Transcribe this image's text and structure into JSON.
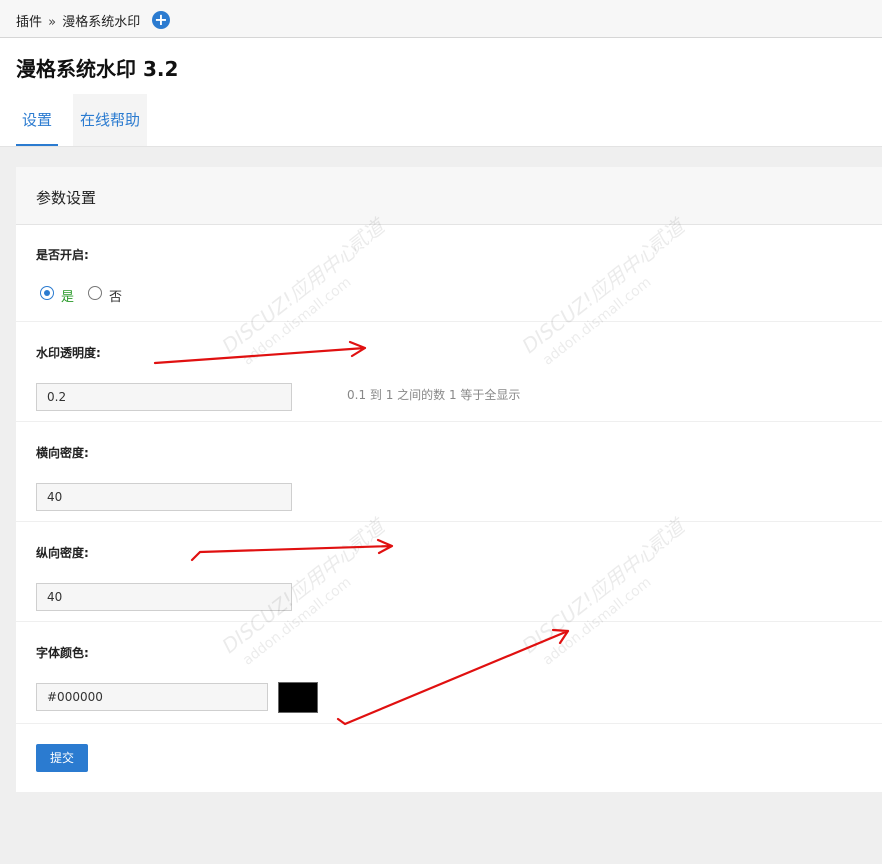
{
  "breadcrumb": {
    "root": "插件",
    "separator": "»",
    "current": "漫格系统水印"
  },
  "header": {
    "title": "漫格系统水印 3.2"
  },
  "tabs": [
    {
      "label": "设置"
    },
    {
      "label": "在线帮助"
    }
  ],
  "panel": {
    "title": "参数设置"
  },
  "form": {
    "enable": {
      "label": "是否开启:",
      "options": [
        "是",
        "否"
      ],
      "selected": "是"
    },
    "opacity": {
      "label": "水印透明度:",
      "value": "0.2",
      "hint": "0.1 到 1 之间的数 1 等于全显示"
    },
    "h_density": {
      "label": "横向密度:",
      "value": "40"
    },
    "v_density": {
      "label": "纵向密度:",
      "value": "40"
    },
    "font_color": {
      "label": "字体颜色:",
      "value": "#000000",
      "swatch": "#000000"
    },
    "submit_label": "提交"
  },
  "watermark": {
    "brand": "DISCUZ!应用中心",
    "site": "addon.dismall.com",
    "tag": "贰道"
  },
  "colors": {
    "accent": "#2b7bd0",
    "annotation": "#e01010",
    "radio_selected_text": "#2a9a2a"
  }
}
